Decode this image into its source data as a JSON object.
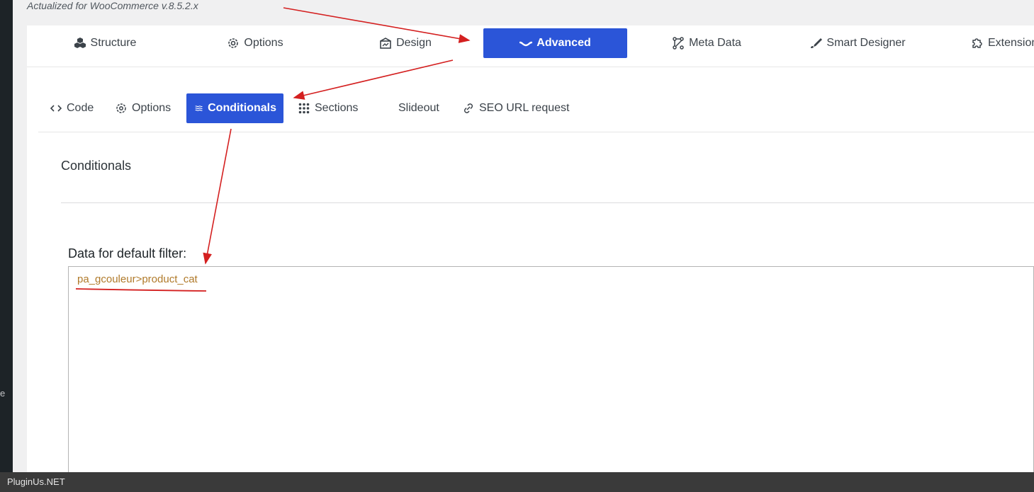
{
  "header": {
    "version_note": "Actualized for WooCommerce v.8.5.2.x"
  },
  "sidebar": {
    "stub_text": "e"
  },
  "main_tabs": [
    {
      "label": "Structure",
      "icon": "cubes-icon"
    },
    {
      "label": "Options",
      "icon": "gear-icon"
    },
    {
      "label": "Design",
      "icon": "design-icon"
    },
    {
      "label": "Advanced",
      "icon": "wave-icon",
      "active": true
    },
    {
      "label": "Meta Data",
      "icon": "nodes-icon"
    },
    {
      "label": "Smart Designer",
      "icon": "brush-icon"
    },
    {
      "label": "Extensions",
      "icon": "puzzle-icon"
    }
  ],
  "sub_tabs": [
    {
      "label": "Code",
      "icon": "code-icon"
    },
    {
      "label": "Options",
      "icon": "gear-icon"
    },
    {
      "label": "Conditionals",
      "icon": "approx-icon",
      "active": true
    },
    {
      "label": "Sections",
      "icon": "grid-dots-icon"
    },
    {
      "label": "Slideout",
      "icon": ""
    },
    {
      "label": "SEO URL request",
      "icon": "link-icon"
    }
  ],
  "section": {
    "title": "Conditionals"
  },
  "field": {
    "label": "Data for default filter:",
    "value": "pa_gcouleur>product_cat"
  },
  "footer": {
    "watermark": "PluginUs.NET"
  },
  "colors": {
    "accent": "#2b55d8",
    "annotation": "#d42020",
    "value_text": "#b07a2a"
  }
}
